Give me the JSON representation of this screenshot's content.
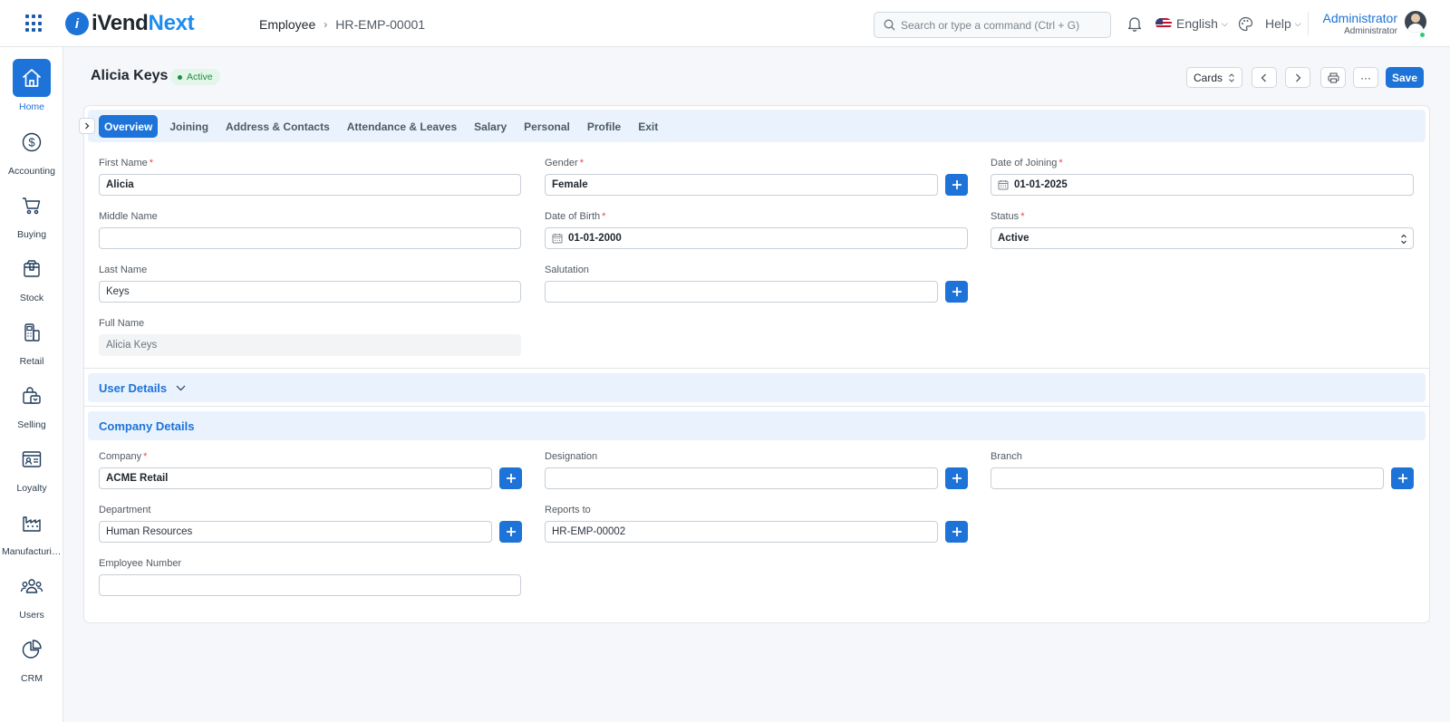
{
  "brand": {
    "mark": "i",
    "name_part1": "iVend",
    "name_part2": "Next"
  },
  "breadcrumb": {
    "parent": "Employee",
    "separator": "›",
    "current": "HR-EMP-00001"
  },
  "search": {
    "placeholder": "Search or type a command (Ctrl + G)"
  },
  "topbar": {
    "language": "English",
    "help": "Help"
  },
  "user": {
    "name": "Administrator",
    "role": "Administrator"
  },
  "sidebar": {
    "items": [
      {
        "label": "Home",
        "icon": "home-icon"
      },
      {
        "label": "Accounting",
        "icon": "dollar-circle-icon"
      },
      {
        "label": "Buying",
        "icon": "cart-icon"
      },
      {
        "label": "Stock",
        "icon": "box-icon"
      },
      {
        "label": "Retail",
        "icon": "pos-terminal-icon"
      },
      {
        "label": "Selling",
        "icon": "shopping-bag-icon"
      },
      {
        "label": "Loyalty",
        "icon": "member-card-icon"
      },
      {
        "label": "Manufacturing",
        "icon": "factory-icon"
      },
      {
        "label": "Users",
        "icon": "users-icon"
      },
      {
        "label": "CRM",
        "icon": "pie-chart-icon"
      }
    ]
  },
  "header": {
    "title": "Alicia Keys",
    "status": "Active",
    "view_select": "Cards",
    "more": "···",
    "save": "Save"
  },
  "tabs": [
    "Overview",
    "Joining",
    "Address & Contacts",
    "Attendance & Leaves",
    "Salary",
    "Personal",
    "Profile",
    "Exit"
  ],
  "overview": {
    "first_name": {
      "label": "First Name",
      "required": "*",
      "value": "Alicia"
    },
    "middle_name": {
      "label": "Middle Name",
      "value": ""
    },
    "last_name": {
      "label": "Last Name",
      "value": "Keys"
    },
    "full_name": {
      "label": "Full Name",
      "value": "Alicia Keys"
    },
    "gender": {
      "label": "Gender",
      "required": "*",
      "value": "Female"
    },
    "date_of_birth": {
      "label": "Date of Birth",
      "required": "*",
      "value": "01-01-2000"
    },
    "salutation": {
      "label": "Salutation",
      "value": ""
    },
    "date_of_joining": {
      "label": "Date of Joining",
      "required": "*",
      "value": "01-01-2025"
    },
    "status": {
      "label": "Status",
      "required": "*",
      "value": "Active"
    }
  },
  "user_details": {
    "title": "User Details"
  },
  "company_details": {
    "title": "Company Details",
    "company": {
      "label": "Company",
      "required": "*",
      "value": "ACME Retail"
    },
    "department": {
      "label": "Department",
      "value": "Human Resources"
    },
    "employee_number": {
      "label": "Employee Number",
      "value": ""
    },
    "designation": {
      "label": "Designation",
      "value": ""
    },
    "reports_to": {
      "label": "Reports to",
      "value": "HR-EMP-00002"
    },
    "branch": {
      "label": "Branch",
      "value": ""
    }
  },
  "colors": {
    "accent": "#1d73d8",
    "active_badge_bg": "#e4f5e9",
    "active_badge_text": "#1e8e3e",
    "section_bg": "#eaf3fd"
  }
}
